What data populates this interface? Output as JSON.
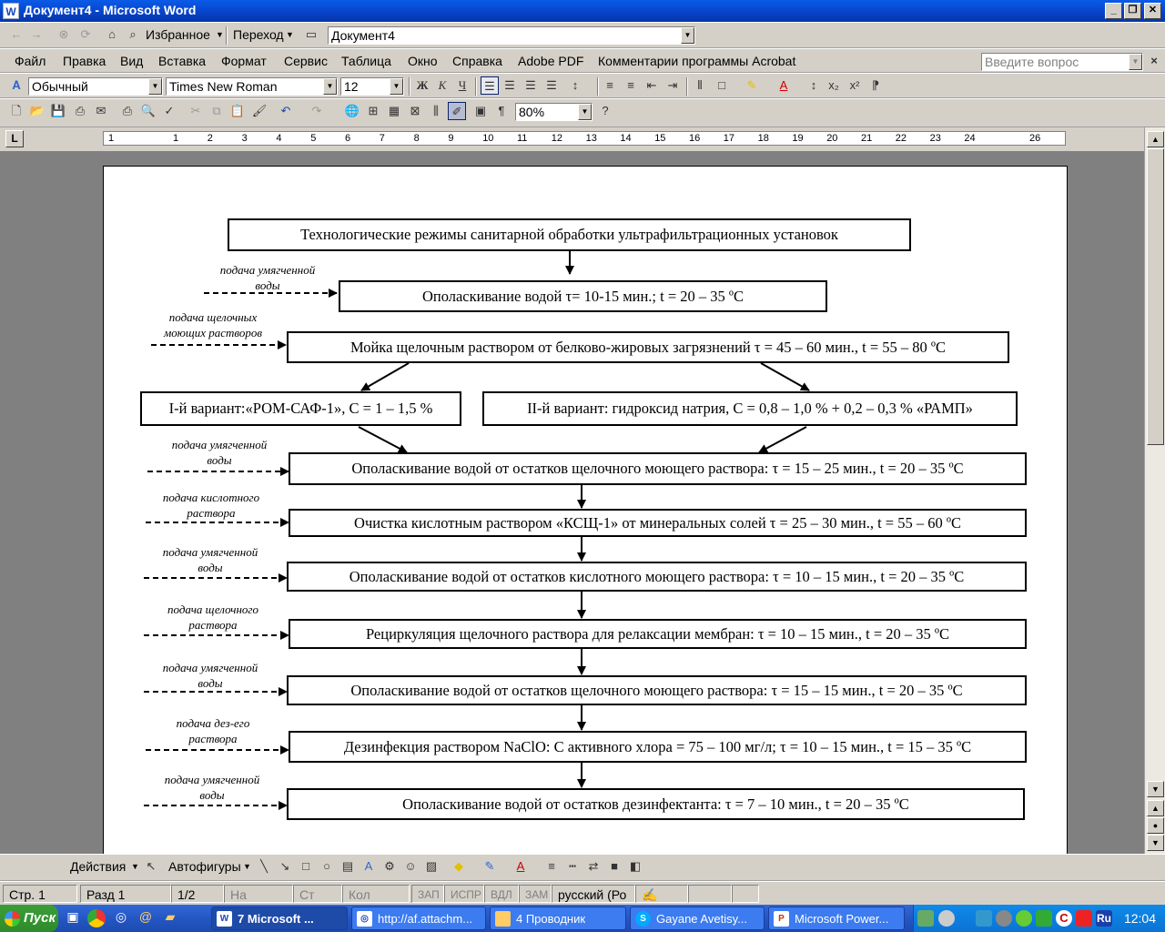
{
  "window": {
    "title": "Документ4 - Microsoft Word",
    "icon": "word-icon"
  },
  "toolbar1": {
    "favorites": "Избранное",
    "goto": "Переход",
    "address": "Документ4"
  },
  "menubar": {
    "items": [
      "Файл",
      "Правка",
      "Вид",
      "Вставка",
      "Формат",
      "Сервис",
      "Таблица",
      "Окно",
      "Справка",
      "Adobe PDF",
      "Комментарии программы Acrobat"
    ],
    "help_placeholder": "Введите вопрос"
  },
  "format": {
    "style": "Обычный",
    "font": "Times New Roman",
    "size": "12"
  },
  "standard": {
    "zoom": "80%"
  },
  "ruler": {
    "tab_label": "L",
    "numbers": [
      "1",
      "1",
      "2",
      "3",
      "4",
      "5",
      "6",
      "7",
      "8",
      "9",
      "10",
      "11",
      "12",
      "13",
      "14",
      "15",
      "16",
      "17",
      "18",
      "19",
      "20",
      "21",
      "22",
      "23",
      "24",
      "26"
    ]
  },
  "doc": {
    "title": "Технологические режимы санитарной обработки ультрафильтрационных установок",
    "step1": "Ополаскивание водой τ= 10-15 мин.; t = 20 – 35 ºС",
    "step2": "Мойка щелочным раствором от белково-жировых загрязнений τ = 45 – 60 мин., t = 55 – 80 ºС",
    "variant1": "I-й вариант:«РОМ-САФ-1», С = 1 – 1,5 %",
    "variant2": "II-й вариант: гидроксид натрия, С = 0,8 – 1,0 % + 0,2 – 0,3 % «РАМП»",
    "step3": "Ополаскивание водой от остатков щелочного моющего раствора: τ = 15 – 25 мин., t = 20 – 35 ºС",
    "step4": "Очистка кислотным раствором «КСЩ-1» от минеральных солей τ = 25 – 30 мин., t = 55 – 60 ºС",
    "step5": "Ополаскивание водой от остатков кислотного моющего раствора: τ = 10 – 15 мин., t = 20 – 35 ºС",
    "step6": "Рециркуляция щелочного раствора для релаксации мембран: τ = 10 – 15 мин., t = 20 – 35 ºС",
    "step7": "Ополаскивание водой от остатков щелочного моющего раствора: τ = 15 – 15 мин., t = 20 – 35 ºС",
    "step8": "Дезинфекция раствором NaClO: С активного хлора = 75 – 100 мг/л; τ = 10 – 15 мин., t = 15 – 35 ºС",
    "step9": "Ополаскивание водой от остатков дезинфектанта: τ = 7 – 10 мин., t = 20 – 35 ºС",
    "notes": {
      "n1a": "подача умягченной",
      "n1b": "воды",
      "n2a": "подача щелочных",
      "n2b": "моющих растворов",
      "n3a": "подача умягченной",
      "n3b": "воды",
      "n4a": "подача кислотного",
      "n4b": "раствора",
      "n5a": "подача умягченной",
      "n5b": "воды",
      "n6a": "подача щелочного",
      "n6b": "раствора",
      "n7a": "подача умягченной",
      "n7b": "воды",
      "n8a": "подача дез-его",
      "n8b": "раствора",
      "n9a": "подача умягченной",
      "n9b": "воды"
    }
  },
  "drawing": {
    "actions": "Действия",
    "autoshapes": "Автофигуры"
  },
  "status": {
    "page": "Стр. 1",
    "section": "Разд 1",
    "pages": "1/2",
    "at": "На",
    "line": "Ст",
    "col": "Кол",
    "rec": "ЗАП",
    "trk": "ИСПР",
    "ext": "ВДЛ",
    "ovr": "ЗАМ",
    "lang": "русский (Ро"
  },
  "taskbar": {
    "start": "Пуск",
    "tasks": [
      "7 Microsoft ...",
      "http://af.attachm...",
      "4 Проводник",
      "Gayane Avetisy...",
      "Microsoft Power..."
    ],
    "lang": "Ru",
    "clock": "12:04"
  }
}
